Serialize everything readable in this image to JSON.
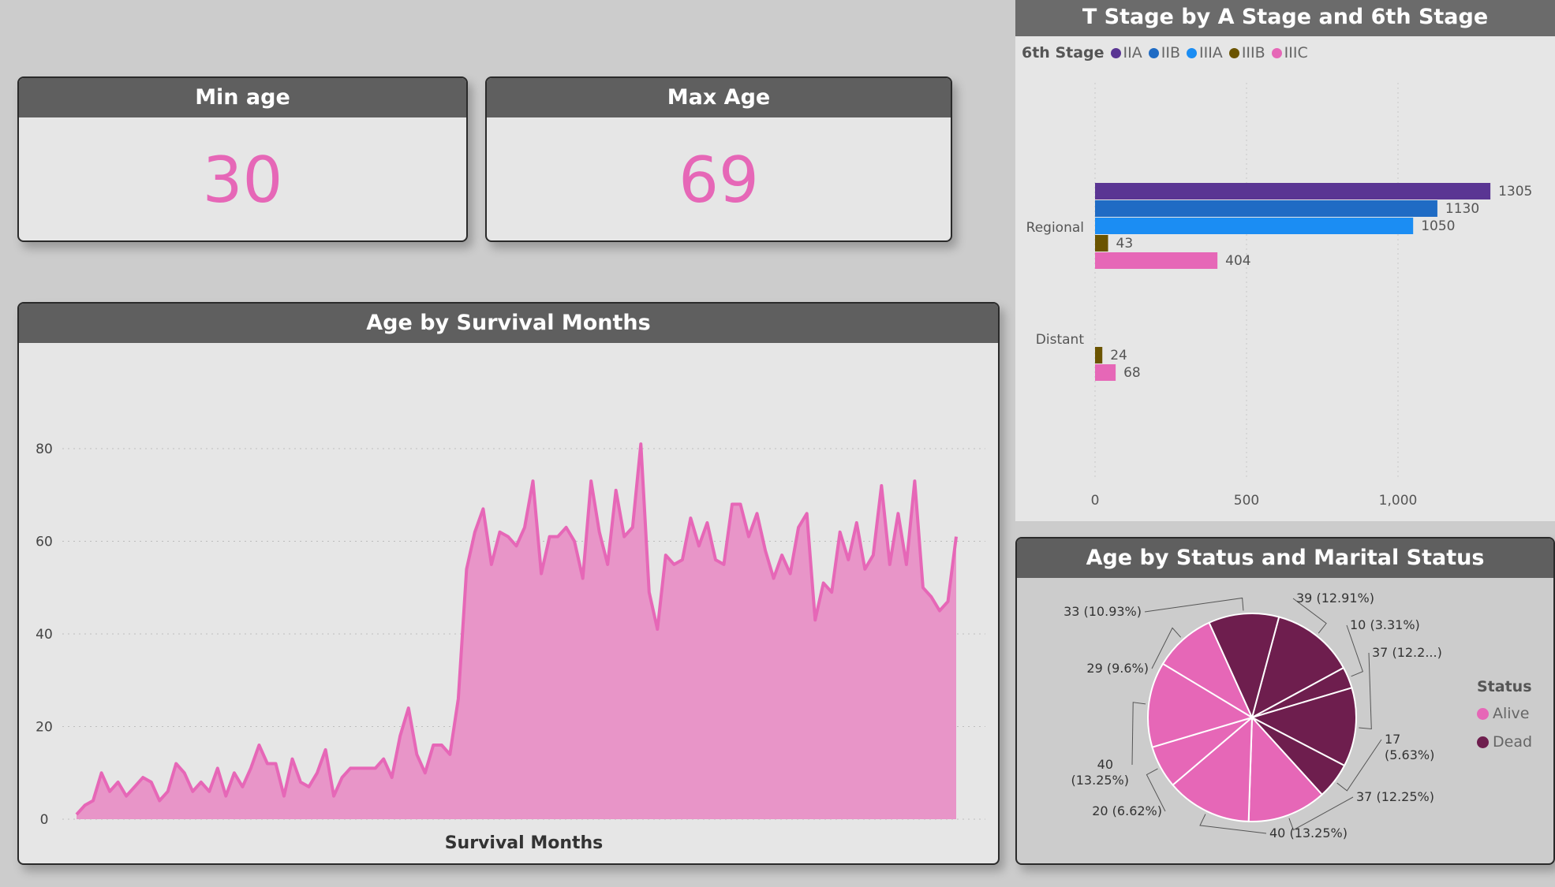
{
  "kpis": {
    "min": {
      "title": "Min age",
      "value": "30"
    },
    "max": {
      "title": "Max Age",
      "value": "69"
    }
  },
  "colors": {
    "pink": "#e667b7",
    "area_fill": "#e895c8",
    "IIA": "#5a3593",
    "IIB": "#1f6bc4",
    "IIIA": "#1b8df3",
    "IIIB": "#6b5400",
    "IIIC": "#e667b7",
    "alive": "#e667b7",
    "dead": "#6e1e4e"
  },
  "chart_data": [
    {
      "type": "area",
      "title": "Age by Survival Months",
      "xlabel": "Survival Months",
      "ylabel": "",
      "ylim": [
        0,
        85
      ],
      "yticks": [
        0,
        20,
        40,
        60,
        80
      ],
      "grid": true,
      "values": [
        1,
        3,
        4,
        10,
        6,
        8,
        5,
        7,
        9,
        8,
        4,
        6,
        12,
        10,
        6,
        8,
        6,
        11,
        5,
        10,
        7,
        11,
        16,
        12,
        12,
        5,
        13,
        8,
        7,
        10,
        15,
        5,
        9,
        11,
        11,
        11,
        11,
        13,
        9,
        18,
        24,
        14,
        10,
        16,
        16,
        14,
        26,
        54,
        62,
        67,
        55,
        62,
        61,
        59,
        63,
        73,
        53,
        61,
        61,
        63,
        60,
        52,
        73,
        62,
        55,
        71,
        61,
        63,
        81,
        49,
        41,
        57,
        55,
        56,
        65,
        59,
        64,
        56,
        55,
        68,
        68,
        61,
        66,
        58,
        52,
        57,
        53,
        63,
        66,
        43,
        51,
        49,
        62,
        56,
        64,
        54,
        57,
        72,
        55,
        66,
        55,
        73,
        50,
        48,
        45,
        47,
        61
      ]
    },
    {
      "type": "bar",
      "orientation": "horizontal",
      "title": "T Stage by A Stage and 6th Stage",
      "legend_title": "6th Stage",
      "legend_position": "top-left",
      "categories": [
        "Regional",
        "Distant"
      ],
      "series": [
        {
          "name": "IIA",
          "values": [
            1305,
            null
          ]
        },
        {
          "name": "IIB",
          "values": [
            1130,
            null
          ]
        },
        {
          "name": "IIIA",
          "values": [
            1050,
            null
          ]
        },
        {
          "name": "IIIB",
          "values": [
            43,
            24
          ]
        },
        {
          "name": "IIIC",
          "values": [
            404,
            68
          ]
        }
      ],
      "xlim": [
        0,
        1400
      ],
      "xticks": [
        0,
        500,
        1000
      ],
      "xtick_labels": [
        "0",
        "500",
        "1,000"
      ],
      "grid": true
    },
    {
      "type": "pie",
      "title": "Age by Status and Marital Status",
      "legend_title": "Status",
      "legend_position": "right",
      "legend": [
        "Alive",
        "Dead"
      ],
      "slices": [
        {
          "value": 39,
          "label": "39 (12.91%)",
          "status": "Dead"
        },
        {
          "value": 10,
          "label": "10 (3.31%)",
          "status": "Dead"
        },
        {
          "value": 37,
          "label": "37 (12.2...)",
          "status": "Dead"
        },
        {
          "value": 17,
          "label": "17 (5.63%)",
          "label_lines": [
            "17",
            "(5.63%)"
          ],
          "status": "Dead"
        },
        {
          "value": 37,
          "label": "37 (12.25%)",
          "status": "Alive"
        },
        {
          "value": 40,
          "label": "40 (13.25%)",
          "status": "Alive"
        },
        {
          "value": 20,
          "label": "20 (6.62%)",
          "status": "Alive"
        },
        {
          "value": 40,
          "label": "40 (13.25%)",
          "label_lines": [
            "40",
            "(13.25%)"
          ],
          "status": "Alive"
        },
        {
          "value": 29,
          "label": "29 (9.6%)",
          "status": "Alive"
        },
        {
          "value": 33,
          "label": "33 (10.93%)",
          "status": "Dead"
        }
      ]
    }
  ]
}
